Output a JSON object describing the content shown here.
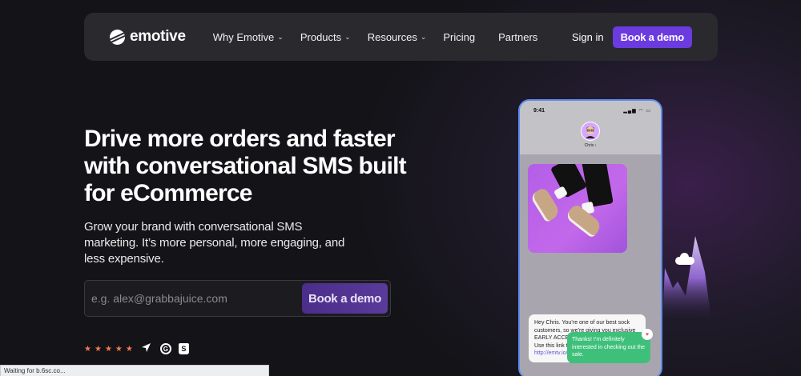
{
  "nav": {
    "logo_text": "emotive",
    "links": [
      {
        "label": "Why Emotive",
        "has_dropdown": true
      },
      {
        "label": "Products",
        "has_dropdown": true
      },
      {
        "label": "Resources",
        "has_dropdown": true
      },
      {
        "label": "Pricing",
        "has_dropdown": false
      },
      {
        "label": "Partners",
        "has_dropdown": false
      }
    ],
    "dropdown_glyph": "⌄",
    "signin_label": "Sign in",
    "cta_label": "Book a demo"
  },
  "hero": {
    "title": "Drive more orders and faster with conversational SMS built for eCommerce",
    "subtitle": "Grow your brand with conversational SMS marketing. It’s more personal, more engaging, and less expensive.",
    "email_placeholder": "e.g. alex@grabbajuice.com",
    "cta_label": "Book a demo"
  },
  "badges": {
    "star_count": 5,
    "icons": [
      "star-icon",
      "send-arrow-icon",
      "g2-icon",
      "shopify-icon"
    ],
    "star_color": "#f27a52"
  },
  "phone": {
    "time": "9:41",
    "status_icons": "▂▄▆ ◠ ▭",
    "contact_name": "Chris",
    "contact_chevron": "›",
    "incoming_message": "Hey Chris. You’re one of our best sock customers, so we’re giving you exclusive EARLY ACCESS to our annual sock sale. Use this link to get a head start!",
    "incoming_link": "http://emtv.io/k8Jh",
    "outgoing_message": "Thanks! I’m definitely interested in checking out the sale.",
    "reaction": "♥"
  },
  "colors": {
    "accent": "#6b3be0",
    "nav_bg": "#2a292e",
    "page_bg": "#161519",
    "outgoing_bubble": "#3fc07a",
    "phone_border": "#5c8cf0"
  },
  "browser_status": "Waiting for b.6sc.co..."
}
